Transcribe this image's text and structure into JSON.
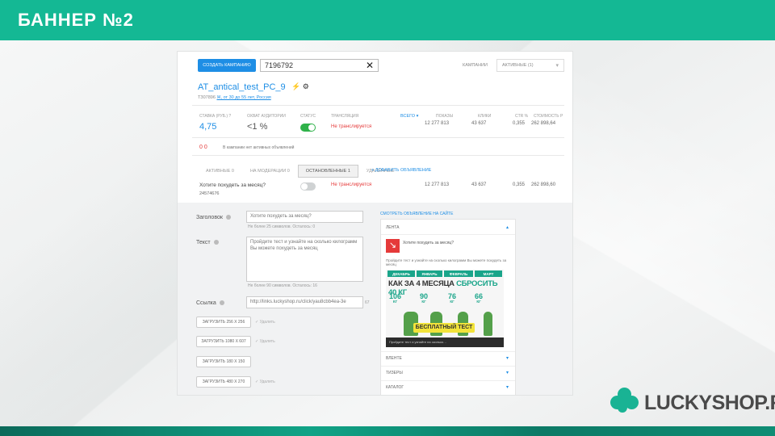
{
  "slide": {
    "title": "БАННЕР №2",
    "brand": "LUCKYSHOP.RU"
  },
  "toolbar": {
    "create_label": "СОЗДАТЬ КАМПАНИЮ",
    "search_value": "7196792",
    "filter_label": "КАМПАНИИ",
    "filter_value": "АКТИВНЫЕ (1)"
  },
  "campaign": {
    "name": "AT_antical_test_PC_9",
    "icons": "⚡ ⚙",
    "subtitle_prefix": "ТЗ07896",
    "subtitle_link": "Ж, от 30 до 55 лет, Россия"
  },
  "stats": {
    "bid_label": "СТАВКА (РУБ.) ?",
    "bid_value": "4,75",
    "reach_label": "ОХВАТ АУДИТОРИИ",
    "reach_value": "<1 %",
    "status_label": "СТАТУС",
    "broadcast_label": "ТРАНСЛЯЦИЯ",
    "broadcast_value": "Не транслируется",
    "period_label": "ВСЕГО ▾",
    "shows_label": "ПОКАЗЫ",
    "shows_value": "12 277 813",
    "clicks_label": "КЛИКИ",
    "clicks_value": "43 637",
    "ctr_label": "CTR %",
    "ctr_value": "0,355",
    "cost_label": "СТОИМОСТЬ Р",
    "cost_value": "262 898,64"
  },
  "notice": {
    "counter": "0 0",
    "text": "В кампании нет активных объявлений"
  },
  "tabs": [
    {
      "label": "АКТИВНЫЕ 0"
    },
    {
      "label": "НА МОДЕРАЦИИ 0"
    },
    {
      "label": "ОСТАНОВЛЕННЫЕ 1"
    },
    {
      "label": "УДАЛЁННЫЕ"
    }
  ],
  "add_ad_label": "+ ДОБАВИТЬ ОБЪЯВЛЕНИЕ",
  "ad_row": {
    "title": "Хотите похудеть за месяц?",
    "id": "24574676",
    "broadcast": "Не транслируется",
    "shows": "12 277 813",
    "clicks": "43 637",
    "ctr": "0,355",
    "cost": "262 898,60"
  },
  "form": {
    "headline_label": "Заголовок",
    "headline_value": "Хотите похудеть за месяц?",
    "headline_hint": "Не более 25 символов. Осталось: 0",
    "text_label": "Текст",
    "text_value": "Пройдите тест и узнайте на сколько килограмм Вы можете похудеть за месяц",
    "text_hint": "Не более 90 символов. Осталось: 16",
    "link_label": "Ссылка",
    "link_value": "http://links.luckyshop.ru/click/yau8cbb4ea-3e",
    "link_count": "67",
    "upload_1": "ЗАГРУЗИТЬ 256 Х 256",
    "upload_2": "ЗАГРУЗИТЬ 1080 Х 607",
    "upload_3": "ЗАГРУЗИТЬ 180 Х 150",
    "upload_4": "ЗАГРУЗИТЬ 480 Х 270",
    "check_1": "✓ Удалить",
    "check_2": "✓ Удалить",
    "check_3": "✓ Удалить"
  },
  "preview": {
    "link": "СМОТРЕТЬ ОБЪЯВЛЕНИЕ НА САЙТЕ",
    "section_1": "ЛЕНТА",
    "ad_title": "Хотите похудеть за месяц?",
    "ad_text": "Пройдите тест и узнайте на сколько килограмм Вы можете похудеть за месяц",
    "months": [
      "ДЕКАБРЬ",
      "ЯНВАРЬ",
      "ФЕВРАЛЬ",
      "МАРТ"
    ],
    "headline_a": "КАК ЗА 4 МЕСЯЦА ",
    "headline_b": "СБРОСИТЬ 40 КГ",
    "weights": [
      "106",
      "90",
      "76",
      "66"
    ],
    "unit": "КГ",
    "cta": "БЕСПЛАТНЫЙ ТЕСТ",
    "footer": "Пройдите тест и узнайте на сколько…",
    "section_2": "ВЛЕНТЕ",
    "section_3": "ТИЗЕРЫ",
    "section_4": "КАТАЛОГ"
  },
  "colors": {
    "accent": "#14b894",
    "link": "#1e8ee5",
    "danger": "#e53a3a",
    "toggle_on": "#2fb24a"
  }
}
